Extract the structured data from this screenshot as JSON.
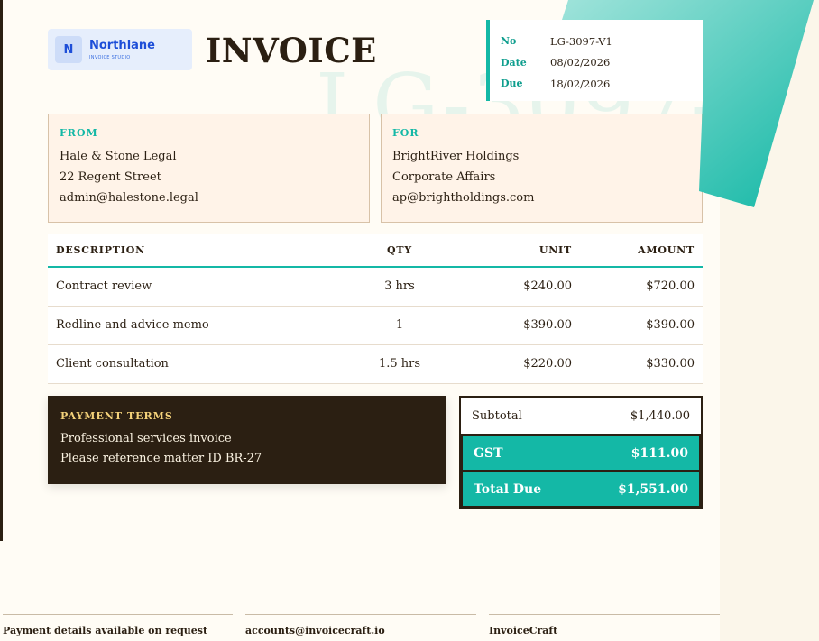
{
  "brand": {
    "initial": "N",
    "name": "Northlane",
    "tagline": "Invoice Studio",
    "accent": "#14b8a6",
    "dark": "#2b1f12"
  },
  "document": {
    "title": "INVOICE",
    "watermark": "LG-3097-V1"
  },
  "meta": [
    {
      "label": "No",
      "value": "LG-3097-V1"
    },
    {
      "label": "Date",
      "value": "08/02/2026"
    },
    {
      "label": "Due",
      "value": "18/02/2026"
    }
  ],
  "from": {
    "heading": "From",
    "lines": [
      "Hale & Stone Legal",
      "22 Regent Street",
      "admin@halestone.legal"
    ]
  },
  "for": {
    "heading": "For",
    "lines": [
      "BrightRiver Holdings",
      "Corporate Affairs",
      "ap@brightholdings.com"
    ]
  },
  "table": {
    "headers": {
      "description": "Description",
      "qty": "Qty",
      "unit": "Unit",
      "amount": "Amount"
    },
    "rows": [
      {
        "description": "Contract review",
        "qty": "3 hrs",
        "unit": "$240.00",
        "amount": "$720.00"
      },
      {
        "description": "Redline and advice memo",
        "qty": "1",
        "unit": "$390.00",
        "amount": "$390.00"
      },
      {
        "description": "Client consultation",
        "qty": "1.5 hrs",
        "unit": "$220.00",
        "amount": "$330.00"
      }
    ]
  },
  "terms": {
    "heading": "Payment Terms",
    "lines": [
      "Professional services invoice",
      "Please reference matter ID BR-27"
    ]
  },
  "totals": {
    "subtotal_label": "Subtotal",
    "subtotal": "$1,440.00",
    "gst_label": "GST",
    "gst": "$111.00",
    "total_label": "Total Due",
    "total": "$1,551.00"
  },
  "footer": [
    "Payment details available on request",
    "accounts@invoicecraft.io",
    "InvoiceCraft"
  ]
}
